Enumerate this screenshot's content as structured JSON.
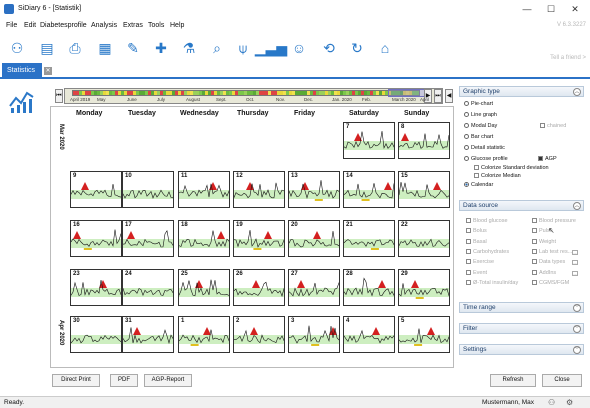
{
  "window": {
    "title": "SiDiary 6 - [Statistik]",
    "min": "—",
    "max": "☐",
    "close": "✕"
  },
  "menu": [
    "File",
    "Edit",
    "Diabetesprofile",
    "Analysis",
    "Extras",
    "Tools",
    "Help"
  ],
  "version": "V 6.3.3227",
  "toolbar_icons": [
    "people-icon",
    "id-card-icon",
    "printer-icon",
    "diary-icon",
    "pen-icon",
    "medication-icon",
    "lab-flask-icon",
    "search-icon",
    "food-icon",
    "statistics-icon",
    "smiley-icon",
    "sync-icon",
    "refresh-icon",
    "teleconsult-icon"
  ],
  "tell_friend": "Tell a friend >",
  "tab": {
    "label": "Statistics",
    "close": "✕"
  },
  "timeline": {
    "months": [
      "April 2019",
      "May",
      "June",
      "July",
      "August",
      "Sept.",
      "Oct.",
      "Nov.",
      "Dec.",
      "Jan. 2020",
      "Feb.",
      "March 2020",
      "April"
    ],
    "nav_left": [
      "⏮",
      "◀"
    ],
    "nav_right": [
      "▶",
      "⏭"
    ]
  },
  "calendar": {
    "days": [
      "Monday",
      "Tuesday",
      "Wednesday",
      "Thursday",
      "Friday",
      "Saturday",
      "Sunday"
    ],
    "week_labels": [
      "Mar 2020",
      "Apr 2020"
    ],
    "weeks": [
      [
        "",
        "",
        "",
        "",
        "",
        "7",
        "8"
      ],
      [
        "9",
        "10",
        "11",
        "12",
        "13",
        "14",
        "15"
      ],
      [
        "16",
        "17",
        "18",
        "19",
        "20",
        "21",
        "22"
      ],
      [
        "23",
        "24",
        "25",
        "26",
        "27",
        "28",
        "29"
      ],
      [
        "30",
        "31",
        "1",
        "2",
        "3",
        "4",
        "5"
      ]
    ]
  },
  "panel": {
    "graphic_type": {
      "header": "Graphic type",
      "options": [
        "Pie-chart",
        "Line graph",
        "Modal Day",
        "Bar chart",
        "Detail statistic",
        "Glucose profile",
        "Calendar"
      ],
      "selected": "Calendar",
      "chained": "chained",
      "agp": "AGP",
      "colorize_sd": "Colorize Standard deviation",
      "colorize_median": "Colorize Median"
    },
    "data_source": {
      "header": "Data source",
      "left": [
        "Blood glucose",
        "Bolus",
        "Basal",
        "Carbohydrates",
        "Exercise",
        "Event",
        "Ø-Total insulin/day"
      ],
      "right": [
        "Blood pressure",
        "Pulse",
        "Weight",
        "Lab test res...",
        "Data types",
        "AddIns",
        "CGMS/FGM"
      ]
    },
    "time_range": "Time range",
    "filter": "Filter",
    "settings": "Settings"
  },
  "buttons": {
    "direct_print": "Direct Print",
    "pdf": "PDF",
    "agp_report": "AGP-Report",
    "refresh": "Refresh",
    "close": "Close"
  },
  "status": {
    "left": "Ready.",
    "user": "Mustermann, Max"
  }
}
